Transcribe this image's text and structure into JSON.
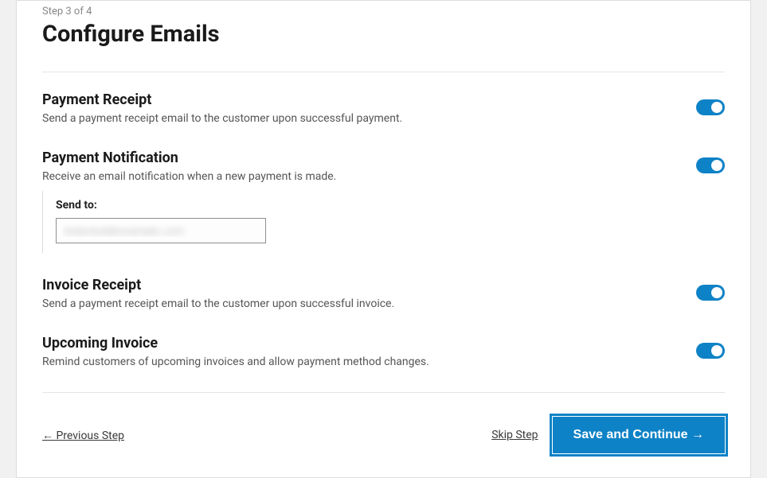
{
  "step_indicator": "Step 3 of 4",
  "page_title": "Configure Emails",
  "settings": {
    "payment_receipt": {
      "title": "Payment Receipt",
      "desc": "Send a payment receipt email to the customer upon successful payment.",
      "enabled": true
    },
    "payment_notification": {
      "title": "Payment Notification",
      "desc": "Receive an email notification when a new payment is made.",
      "enabled": true,
      "send_to_label": "Send to:",
      "send_to_value": "redacted@example.com"
    },
    "invoice_receipt": {
      "title": "Invoice Receipt",
      "desc": "Send a payment receipt email to the customer upon successful invoice.",
      "enabled": true
    },
    "upcoming_invoice": {
      "title": "Upcoming Invoice",
      "desc": "Remind customers of upcoming invoices and allow payment method changes.",
      "enabled": true
    }
  },
  "footer": {
    "previous_label": "← Previous Step",
    "skip_label": "Skip Step",
    "save_label": "Save and Continue →"
  },
  "colors": {
    "accent": "#0e82c6"
  }
}
